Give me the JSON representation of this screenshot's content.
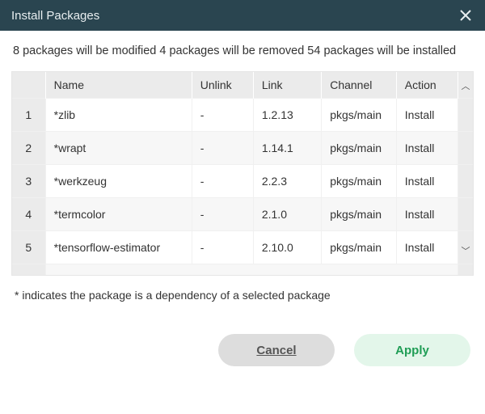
{
  "header": {
    "title": "Install Packages"
  },
  "summary": "8 packages will be modified 4 packages will be removed 54 packages will be installed",
  "columns": {
    "name": "Name",
    "unlink": "Unlink",
    "link": "Link",
    "channel": "Channel",
    "action": "Action"
  },
  "rows": [
    {
      "idx": "1",
      "name": "*zlib",
      "unlink": "-",
      "link": "1.2.13",
      "channel": "pkgs/main",
      "action": "Install"
    },
    {
      "idx": "2",
      "name": "*wrapt",
      "unlink": "-",
      "link": "1.14.1",
      "channel": "pkgs/main",
      "action": "Install"
    },
    {
      "idx": "3",
      "name": "*werkzeug",
      "unlink": "-",
      "link": "2.2.3",
      "channel": "pkgs/main",
      "action": "Install"
    },
    {
      "idx": "4",
      "name": "*termcolor",
      "unlink": "-",
      "link": "2.1.0",
      "channel": "pkgs/main",
      "action": "Install"
    },
    {
      "idx": "5",
      "name": "*tensorflow-estimator",
      "unlink": "-",
      "link": "2.10.0",
      "channel": "pkgs/main",
      "action": "Install"
    }
  ],
  "footnote": "* indicates the package is a dependency of a selected package",
  "buttons": {
    "cancel": "Cancel",
    "apply": "Apply"
  },
  "glyphs": {
    "up": "︿",
    "down": "﹀"
  }
}
